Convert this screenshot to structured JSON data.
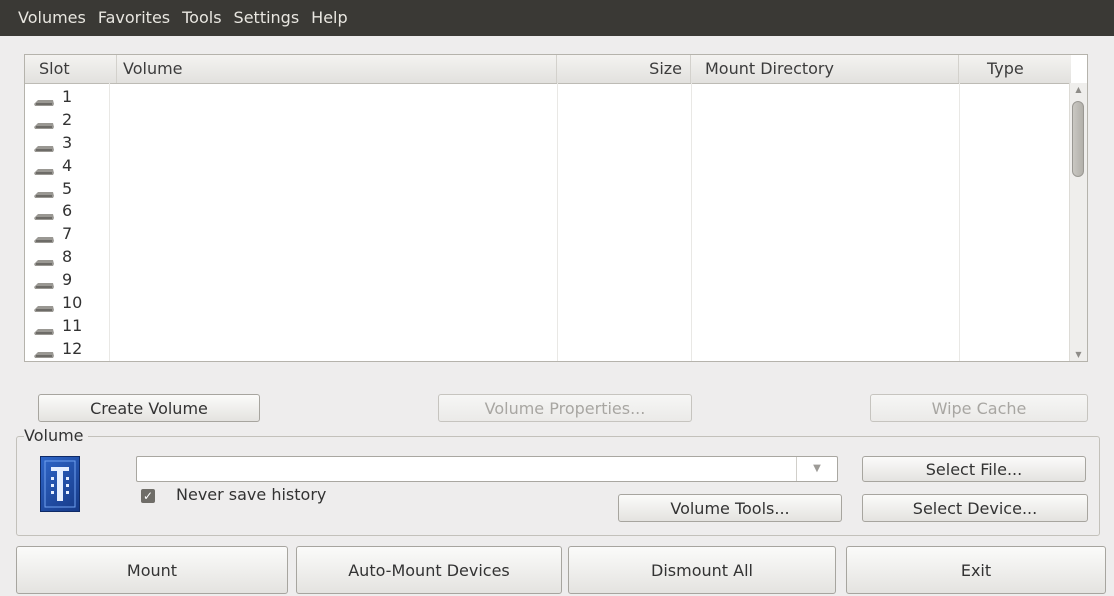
{
  "menubar": {
    "items": [
      "Volumes",
      "Favorites",
      "Tools",
      "Settings",
      "Help"
    ]
  },
  "volume_list": {
    "columns": [
      "Slot",
      "Volume",
      "Size",
      "Mount Directory",
      "Type"
    ],
    "slots": [
      "1",
      "2",
      "3",
      "4",
      "5",
      "6",
      "7",
      "8",
      "9",
      "10",
      "11",
      "12"
    ],
    "slot_icon": "drive-icon"
  },
  "actions": {
    "create_volume": "Create Volume",
    "volume_properties": "Volume Properties...",
    "wipe_cache": "Wipe Cache"
  },
  "volume_group": {
    "title": "Volume",
    "path_value": "",
    "never_save_history_label": "Never save history",
    "never_save_history_checked": true,
    "select_file": "Select File...",
    "volume_tools": "Volume Tools...",
    "select_device": "Select Device..."
  },
  "bottom": {
    "mount": "Mount",
    "auto_mount": "Auto-Mount Devices",
    "dismount_all": "Dismount All",
    "exit": "Exit"
  },
  "colors": {
    "menubar_bg": "#3a3935",
    "window_bg": "#eeeded",
    "logo_blue": "#2f66c8"
  }
}
